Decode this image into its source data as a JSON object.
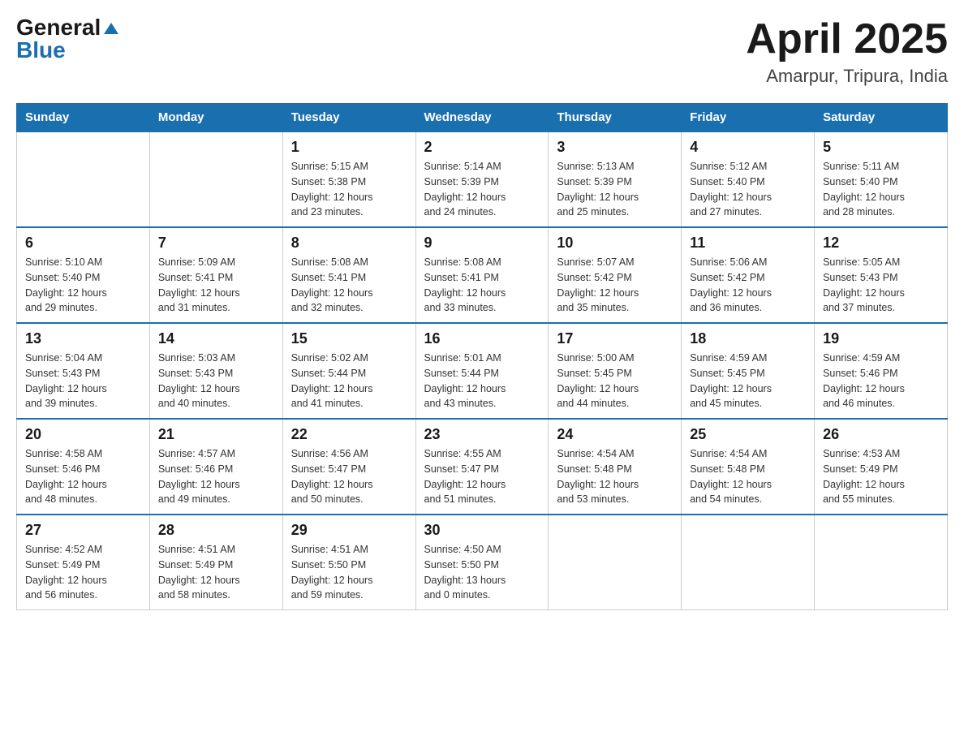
{
  "header": {
    "logo_general": "General",
    "logo_blue": "Blue",
    "title": "April 2025",
    "location": "Amarpur, Tripura, India"
  },
  "days_of_week": [
    "Sunday",
    "Monday",
    "Tuesday",
    "Wednesday",
    "Thursday",
    "Friday",
    "Saturday"
  ],
  "weeks": [
    [
      {
        "day": "",
        "info": ""
      },
      {
        "day": "",
        "info": ""
      },
      {
        "day": "1",
        "info": "Sunrise: 5:15 AM\nSunset: 5:38 PM\nDaylight: 12 hours\nand 23 minutes."
      },
      {
        "day": "2",
        "info": "Sunrise: 5:14 AM\nSunset: 5:39 PM\nDaylight: 12 hours\nand 24 minutes."
      },
      {
        "day": "3",
        "info": "Sunrise: 5:13 AM\nSunset: 5:39 PM\nDaylight: 12 hours\nand 25 minutes."
      },
      {
        "day": "4",
        "info": "Sunrise: 5:12 AM\nSunset: 5:40 PM\nDaylight: 12 hours\nand 27 minutes."
      },
      {
        "day": "5",
        "info": "Sunrise: 5:11 AM\nSunset: 5:40 PM\nDaylight: 12 hours\nand 28 minutes."
      }
    ],
    [
      {
        "day": "6",
        "info": "Sunrise: 5:10 AM\nSunset: 5:40 PM\nDaylight: 12 hours\nand 29 minutes."
      },
      {
        "day": "7",
        "info": "Sunrise: 5:09 AM\nSunset: 5:41 PM\nDaylight: 12 hours\nand 31 minutes."
      },
      {
        "day": "8",
        "info": "Sunrise: 5:08 AM\nSunset: 5:41 PM\nDaylight: 12 hours\nand 32 minutes."
      },
      {
        "day": "9",
        "info": "Sunrise: 5:08 AM\nSunset: 5:41 PM\nDaylight: 12 hours\nand 33 minutes."
      },
      {
        "day": "10",
        "info": "Sunrise: 5:07 AM\nSunset: 5:42 PM\nDaylight: 12 hours\nand 35 minutes."
      },
      {
        "day": "11",
        "info": "Sunrise: 5:06 AM\nSunset: 5:42 PM\nDaylight: 12 hours\nand 36 minutes."
      },
      {
        "day": "12",
        "info": "Sunrise: 5:05 AM\nSunset: 5:43 PM\nDaylight: 12 hours\nand 37 minutes."
      }
    ],
    [
      {
        "day": "13",
        "info": "Sunrise: 5:04 AM\nSunset: 5:43 PM\nDaylight: 12 hours\nand 39 minutes."
      },
      {
        "day": "14",
        "info": "Sunrise: 5:03 AM\nSunset: 5:43 PM\nDaylight: 12 hours\nand 40 minutes."
      },
      {
        "day": "15",
        "info": "Sunrise: 5:02 AM\nSunset: 5:44 PM\nDaylight: 12 hours\nand 41 minutes."
      },
      {
        "day": "16",
        "info": "Sunrise: 5:01 AM\nSunset: 5:44 PM\nDaylight: 12 hours\nand 43 minutes."
      },
      {
        "day": "17",
        "info": "Sunrise: 5:00 AM\nSunset: 5:45 PM\nDaylight: 12 hours\nand 44 minutes."
      },
      {
        "day": "18",
        "info": "Sunrise: 4:59 AM\nSunset: 5:45 PM\nDaylight: 12 hours\nand 45 minutes."
      },
      {
        "day": "19",
        "info": "Sunrise: 4:59 AM\nSunset: 5:46 PM\nDaylight: 12 hours\nand 46 minutes."
      }
    ],
    [
      {
        "day": "20",
        "info": "Sunrise: 4:58 AM\nSunset: 5:46 PM\nDaylight: 12 hours\nand 48 minutes."
      },
      {
        "day": "21",
        "info": "Sunrise: 4:57 AM\nSunset: 5:46 PM\nDaylight: 12 hours\nand 49 minutes."
      },
      {
        "day": "22",
        "info": "Sunrise: 4:56 AM\nSunset: 5:47 PM\nDaylight: 12 hours\nand 50 minutes."
      },
      {
        "day": "23",
        "info": "Sunrise: 4:55 AM\nSunset: 5:47 PM\nDaylight: 12 hours\nand 51 minutes."
      },
      {
        "day": "24",
        "info": "Sunrise: 4:54 AM\nSunset: 5:48 PM\nDaylight: 12 hours\nand 53 minutes."
      },
      {
        "day": "25",
        "info": "Sunrise: 4:54 AM\nSunset: 5:48 PM\nDaylight: 12 hours\nand 54 minutes."
      },
      {
        "day": "26",
        "info": "Sunrise: 4:53 AM\nSunset: 5:49 PM\nDaylight: 12 hours\nand 55 minutes."
      }
    ],
    [
      {
        "day": "27",
        "info": "Sunrise: 4:52 AM\nSunset: 5:49 PM\nDaylight: 12 hours\nand 56 minutes."
      },
      {
        "day": "28",
        "info": "Sunrise: 4:51 AM\nSunset: 5:49 PM\nDaylight: 12 hours\nand 58 minutes."
      },
      {
        "day": "29",
        "info": "Sunrise: 4:51 AM\nSunset: 5:50 PM\nDaylight: 12 hours\nand 59 minutes."
      },
      {
        "day": "30",
        "info": "Sunrise: 4:50 AM\nSunset: 5:50 PM\nDaylight: 13 hours\nand 0 minutes."
      },
      {
        "day": "",
        "info": ""
      },
      {
        "day": "",
        "info": ""
      },
      {
        "day": "",
        "info": ""
      }
    ]
  ]
}
